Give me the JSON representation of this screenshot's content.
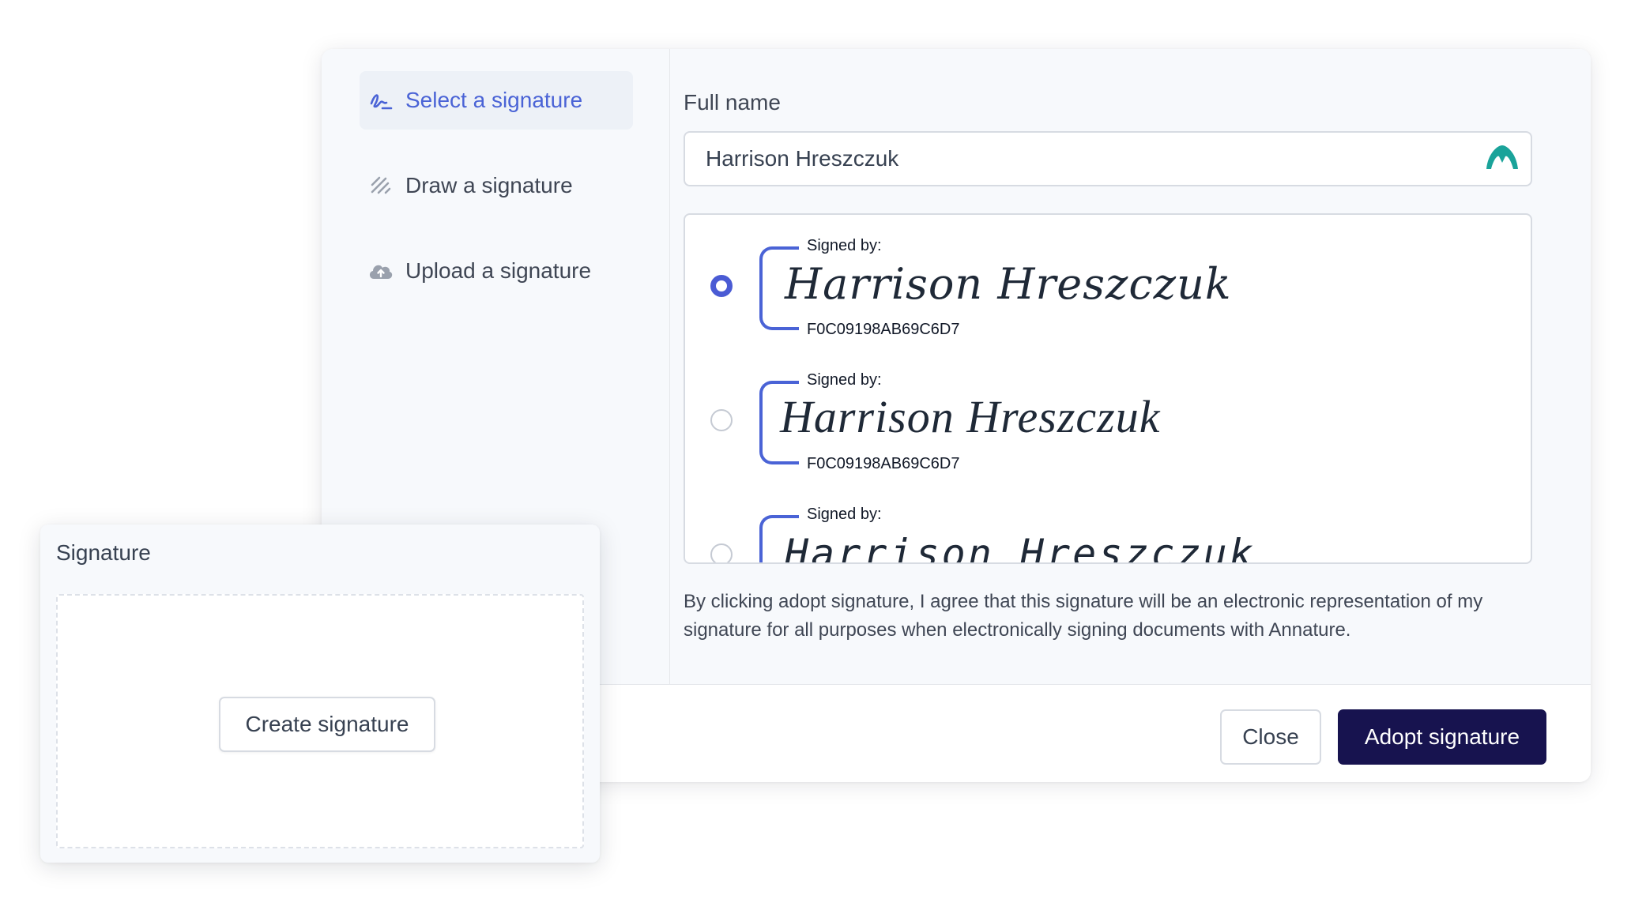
{
  "dialog": {
    "nav": [
      {
        "label": "Select a signature",
        "icon": "signature-pen-icon",
        "active": true
      },
      {
        "label": "Draw a signature",
        "icon": "scribble-icon",
        "active": false
      },
      {
        "label": "Upload a signature",
        "icon": "cloud-upload-icon",
        "active": false
      }
    ],
    "full_name_label": "Full name",
    "full_name_value": "Harrison Hreszczuk",
    "signature_options": [
      {
        "signed_by": "Signed by:",
        "name": "Harrison Hreszczuk",
        "id": "F0C09198AB69C6D7",
        "selected": true
      },
      {
        "signed_by": "Signed by:",
        "name": "Harrison Hreszczuk",
        "id": "F0C09198AB69C6D7",
        "selected": false
      },
      {
        "signed_by": "Signed by:",
        "name": "Harrison Hreszczuk",
        "id": "",
        "selected": false
      }
    ],
    "disclaimer": "By clicking adopt signature, I agree that this signature will be an electronic representation of my signature for all purposes when electronically signing documents with Annature.",
    "close_label": "Close",
    "adopt_label": "Adopt signature"
  },
  "signature_card": {
    "title": "Signature",
    "create_label": "Create signature"
  },
  "colors": {
    "accent": "#4a63d6",
    "primary_button": "#17134f",
    "logo": "#1aa39a",
    "panel_bg": "#f7f9fc"
  }
}
